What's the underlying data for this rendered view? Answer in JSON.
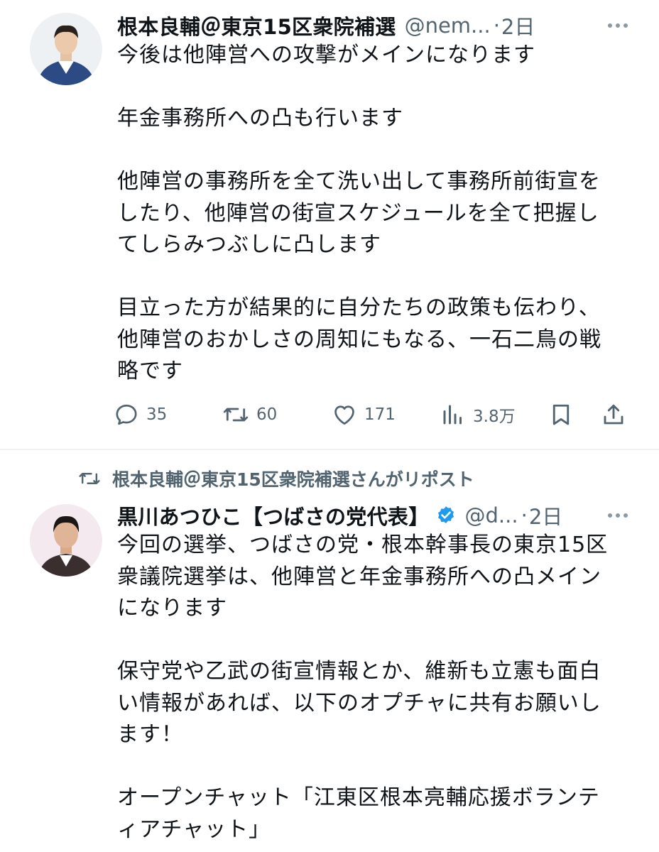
{
  "tweets": [
    {
      "display_name": "根本良輔＠東京15区衆院補選",
      "handle": "@nem...",
      "separator": "·",
      "time": "2日",
      "text": "今後は他陣営への攻撃がメインになります\n\n年金事務所への凸も行います\n\n他陣営の事務所を全て洗い出して事務所前街宣を\nしたり、他陣営の街宣スケジュールを全て把握し\nてしらみつぶしに凸します\n\n目立った方が結果的に自分たちの政策も伝わり、\n他陣営のおかしさの周知にもなる、一石二鳥の戦\n略です",
      "actions": {
        "reply_icon": "reply-icon",
        "reply_count": "35",
        "retweet_icon": "retweet-icon",
        "retweet_count": "60",
        "like_icon": "heart-icon",
        "like_count": "171",
        "views_icon": "analytics-icon",
        "views_count": "3.8万",
        "bookmark_icon": "bookmark-icon",
        "share_icon": "share-icon"
      }
    },
    {
      "repost_label": "根本良輔＠東京15区衆院補選さんがリポスト",
      "display_name": "黒川あつひこ【つばさの党代表】",
      "verified": true,
      "handle": "@d...",
      "separator": "·",
      "time": "2日",
      "text": "今回の選挙、つばさの党・根本幹事長の東京15区\n衆議院選挙は、他陣営と年金事務所への凸メイン\nになります\n\n保守党や乙武の街宣情報とか、維新も立憲も面白\nい情報があれば、以下のオプチャに共有お願いし\nます！\n\nオープンチャット「江東区根本亮輔応援ボランテ\nィアチャット」"
    }
  ],
  "colors": {
    "text": "#0f1419",
    "secondary": "#536471",
    "verified": "#1d9bf0",
    "divider": "#eff3f4"
  }
}
